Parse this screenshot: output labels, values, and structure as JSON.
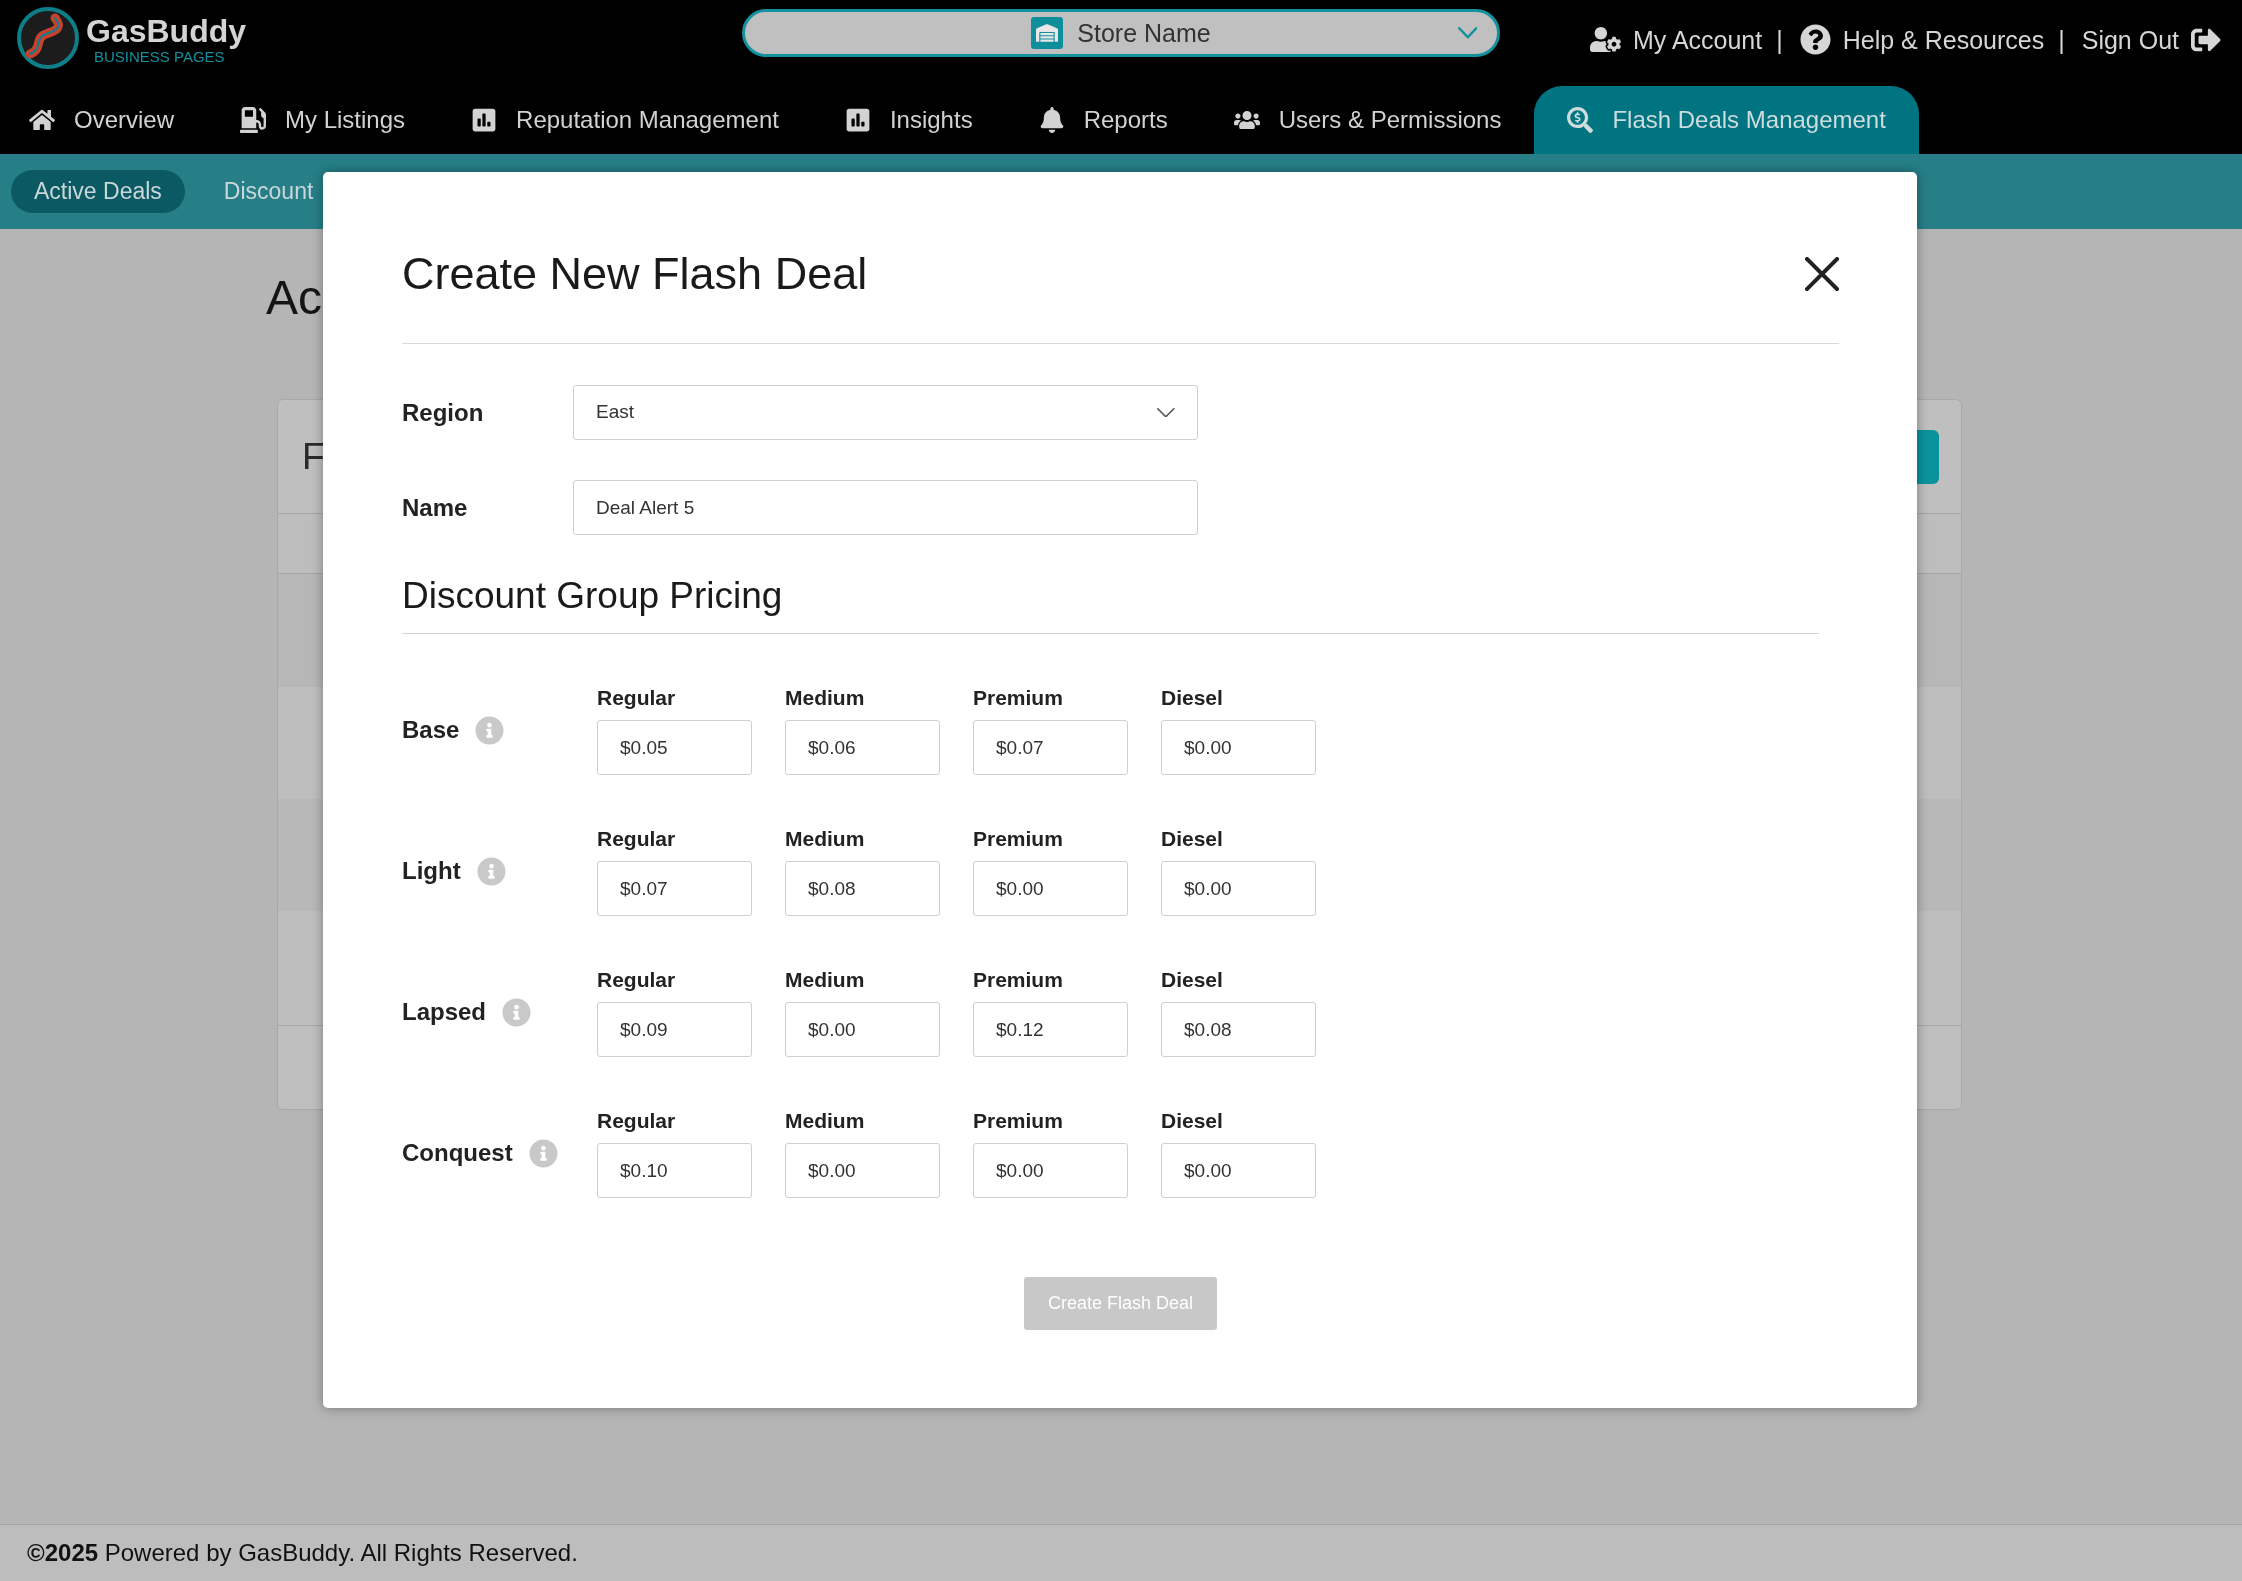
{
  "header": {
    "logo": {
      "name": "GasBuddy",
      "tagline": "BUSINESS PAGES"
    },
    "store_selector": {
      "value": "Store Name"
    },
    "top_links": [
      {
        "kind": "account",
        "label": "My Account",
        "separator": "|"
      },
      {
        "kind": "help",
        "label": "Help & Resources",
        "separator": "|"
      },
      {
        "kind": "signout",
        "label": "Sign Out"
      }
    ]
  },
  "nav": [
    {
      "kind": "home",
      "label": "Overview",
      "selected": false
    },
    {
      "kind": "pump",
      "label": "My Listings",
      "selected": false
    },
    {
      "kind": "chart",
      "label": "Reputation Management",
      "selected": false
    },
    {
      "kind": "chart",
      "label": "Insights",
      "selected": false
    },
    {
      "kind": "bell",
      "label": "Reports",
      "selected": false
    },
    {
      "kind": "users",
      "label": "Users & Permissions",
      "selected": false
    },
    {
      "kind": "search_dollar",
      "label": "Flash Deals Management",
      "selected": true
    }
  ],
  "subnav": [
    {
      "label": "Active Deals",
      "selected": true
    },
    {
      "label": "Discount",
      "selected": false
    }
  ],
  "page": {
    "heading": "Ac",
    "card": {
      "title": "F"
    }
  },
  "modal": {
    "title": "Create New Flash Deal",
    "fields": [
      {
        "kind": "select",
        "label": "Region",
        "value": "East"
      },
      {
        "kind": "text",
        "label": "Name",
        "value": "Deal Alert 5"
      }
    ],
    "section_title": "Discount Group Pricing",
    "groups": [
      {
        "label": "Base",
        "prices": [
          {
            "label": "Regular",
            "value": "$0.05"
          },
          {
            "label": "Medium",
            "value": "$0.06"
          },
          {
            "label": "Premium",
            "value": "$0.07"
          },
          {
            "label": "Diesel",
            "value": "$0.00"
          }
        ]
      },
      {
        "label": "Light",
        "prices": [
          {
            "label": "Regular",
            "value": "$0.07"
          },
          {
            "label": "Medium",
            "value": "$0.08"
          },
          {
            "label": "Premium",
            "value": "$0.00"
          },
          {
            "label": "Diesel",
            "value": "$0.00"
          }
        ]
      },
      {
        "label": "Lapsed",
        "prices": [
          {
            "label": "Regular",
            "value": "$0.09"
          },
          {
            "label": "Medium",
            "value": "$0.00"
          },
          {
            "label": "Premium",
            "value": "$0.12"
          },
          {
            "label": "Diesel",
            "value": "$0.08"
          }
        ]
      },
      {
        "label": "Conquest",
        "prices": [
          {
            "label": "Regular",
            "value": "$0.10"
          },
          {
            "label": "Medium",
            "value": "$0.00"
          },
          {
            "label": "Premium",
            "value": "$0.00"
          },
          {
            "label": "Diesel",
            "value": "$0.00"
          }
        ]
      }
    ],
    "submit": {
      "label": "Create Flash Deal",
      "disabled": true
    }
  },
  "footer": {
    "text": "**©2025** Powered by GasBuddy. All Rights Reserved."
  }
}
